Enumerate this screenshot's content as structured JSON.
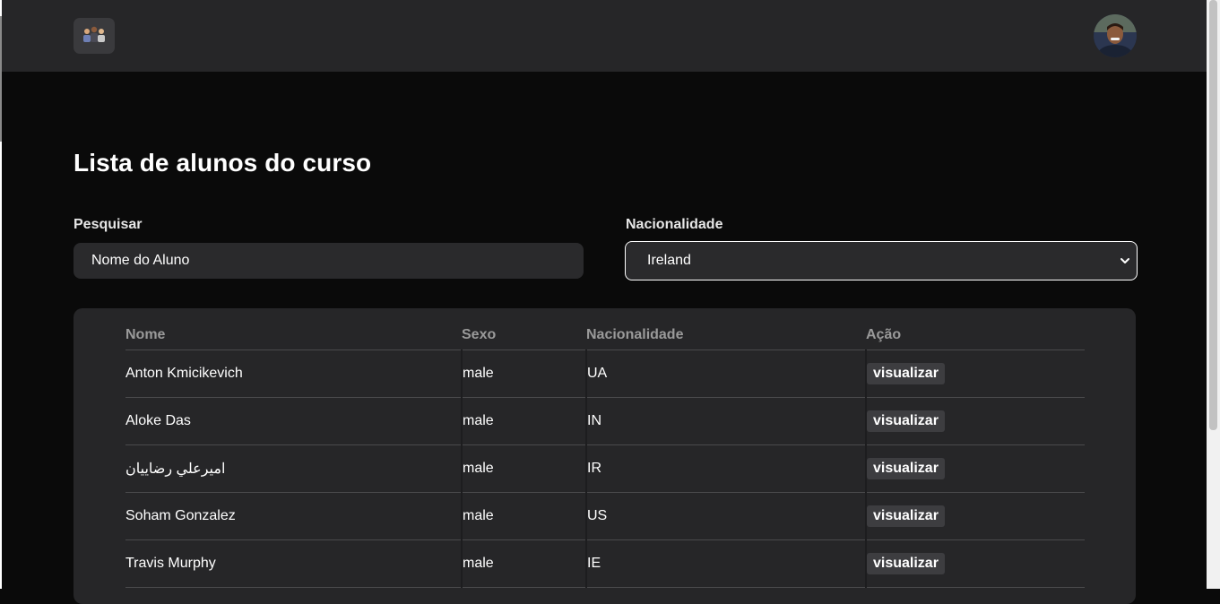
{
  "header": {
    "logo_icon": "people-group-icon",
    "avatar_icon": "user-avatar-icon"
  },
  "page": {
    "title": "Lista de alunos do curso"
  },
  "filters": {
    "search_label": "Pesquisar",
    "search_placeholder": "Nome do Aluno",
    "nationality_label": "Nacionalidade",
    "nationality_selected": "Ireland"
  },
  "table": {
    "columns": [
      "Nome",
      "Sexo",
      "Nacionalidade",
      "Ação"
    ],
    "rows": [
      {
        "name": "Anton Kmicikevich",
        "sex": "male",
        "nat": "UA",
        "action": "visualizar"
      },
      {
        "name": "Aloke Das",
        "sex": "male",
        "nat": "IN",
        "action": "visualizar"
      },
      {
        "name": "اميرعلي رضاييان",
        "sex": "male",
        "nat": "IR",
        "action": "visualizar"
      },
      {
        "name": "Soham Gonzalez",
        "sex": "male",
        "nat": "US",
        "action": "visualizar"
      },
      {
        "name": "Travis Murphy",
        "sex": "male",
        "nat": "IE",
        "action": "visualizar"
      }
    ]
  },
  "colors": {
    "background": "#0a0a0a",
    "topbar": "#262628",
    "card": "#262628",
    "button": "#3d3d40"
  }
}
